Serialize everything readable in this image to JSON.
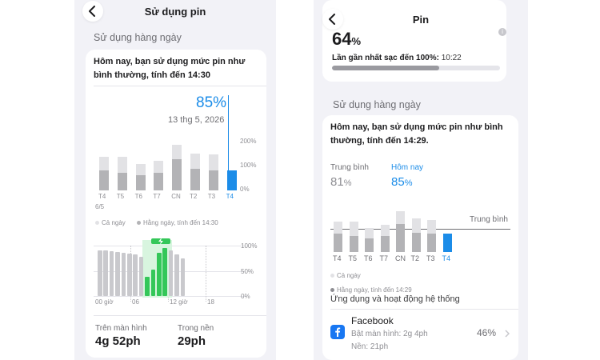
{
  "left": {
    "title": "Sử dụng pin",
    "section": "Sử dụng hàng ngày",
    "summary": "Hôm nay, bạn sử dụng mức pin như bình thường, tính đến 14:30",
    "selected_percent": "85%",
    "selected_date": "13 thg 5, 2026",
    "y_ticks": [
      "200%",
      "100%",
      "0%"
    ],
    "days": [
      "T4",
      "T5",
      "T6",
      "T7",
      "CN",
      "T2",
      "T3",
      "T4"
    ],
    "first_day_sub": "6/5",
    "legend_all": "Cả ngày",
    "legend_daily": "Hằng ngày, tính đến 14:30",
    "hourly_y_ticks": [
      "100%",
      "50%",
      "0%"
    ],
    "hour_labels": [
      "00 giờ",
      "06",
      "12 giờ",
      "18"
    ],
    "screen_on_label": "Trên màn hình",
    "screen_on_value": "4g 52ph",
    "background_label": "Trong nền",
    "background_value": "29ph",
    "daily_usage": [
      {
        "day": "T4",
        "all_day": 140,
        "until_now": 85
      },
      {
        "day": "T5",
        "all_day": 140,
        "until_now": 75
      },
      {
        "day": "T6",
        "all_day": 110,
        "until_now": 65
      },
      {
        "day": "T7",
        "all_day": 125,
        "until_now": 75
      },
      {
        "day": "CN",
        "all_day": 190,
        "until_now": 130
      },
      {
        "day": "T2",
        "all_day": 155,
        "until_now": 90
      },
      {
        "day": "T3",
        "all_day": 150,
        "until_now": 85
      },
      {
        "day": "T4",
        "all_day": 85,
        "until_now": 85
      }
    ],
    "colors": {
      "accent": "#1b8ce8",
      "charging": "#34c759",
      "bar_light": "#e2e2e5",
      "bar_dark": "#b3b3b6"
    }
  },
  "right": {
    "title": "Pin",
    "battery_level": "64",
    "battery_unit": "%",
    "battery_fill": 0.64,
    "last_charge_label": "Lần gần nhất sạc đến 100%:",
    "last_charge_time": "10:22",
    "section": "Sử dụng hàng ngày",
    "summary": "Hôm nay, bạn sử dụng mức pin như bình thường, tính đến 14:29.",
    "average_label": "Trung bình",
    "average_value": "81",
    "average_unit": "%",
    "today_label": "Hôm nay",
    "today_value": "85",
    "today_unit": "%",
    "average_line_label": "Trung bình",
    "days": [
      "T4",
      "T5",
      "T6",
      "T7",
      "CN",
      "T2",
      "T3",
      "T4"
    ],
    "legend_all": "Cả ngày",
    "legend_daily": "Hằng ngày, tính đến 14:29",
    "apps_header": "Ứng dụng và hoạt động hệ thống",
    "app": {
      "name": "Facebook",
      "screen_time": "Bật màn hình: 2g 4ph",
      "background_time": "Nền: 21ph",
      "percent": "46%"
    },
    "colors": {
      "accent": "#1b8ce8",
      "facebook": "#1877f2"
    }
  }
}
